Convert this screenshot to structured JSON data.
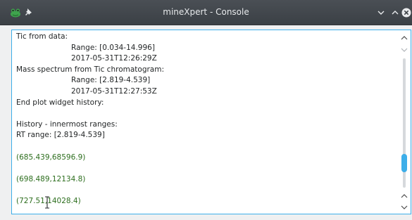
{
  "window": {
    "title": "mineXpert - Console"
  },
  "icons": {
    "app": "frog-app-icon",
    "pin": "pin-icon",
    "minimize": "chevron-down-icon",
    "maximize": "chevron-up-icon",
    "close": "close-icon",
    "text_cursor": "text-cursor-icon"
  },
  "colors": {
    "titlebar": "#474c52",
    "accent": "#3daee9",
    "green_text": "#2d6e1e"
  },
  "console": {
    "lines": [
      {
        "text": "Tic from data:",
        "style": "normal"
      },
      {
        "text": "Range: [0.034-14.996]",
        "style": "indent"
      },
      {
        "text": "2017-05-31T12:26:29Z",
        "style": "indent"
      },
      {
        "text": "Mass spectrum from Tic chromatogram:",
        "style": "normal"
      },
      {
        "text": "Range: [2.819-4.539]",
        "style": "indent"
      },
      {
        "text": "2017-05-31T12:27:53Z",
        "style": "indent"
      },
      {
        "text": "End plot widget history:",
        "style": "normal"
      },
      {
        "text": "",
        "style": "normal"
      },
      {
        "text": "History - innermost ranges:",
        "style": "normal"
      },
      {
        "text": "RT range: [2.819-4.539]",
        "style": "normal"
      },
      {
        "text": "",
        "style": "normal"
      },
      {
        "text": "(685.439,68596.9)",
        "style": "green"
      },
      {
        "text": "",
        "style": "normal"
      },
      {
        "text": "(698.489,12134.8)",
        "style": "green"
      },
      {
        "text": "",
        "style": "normal"
      },
      {
        "text": "(727.51,14028.4)",
        "style": "green"
      }
    ]
  },
  "scrollbar": {
    "position_fraction": 0.86
  }
}
